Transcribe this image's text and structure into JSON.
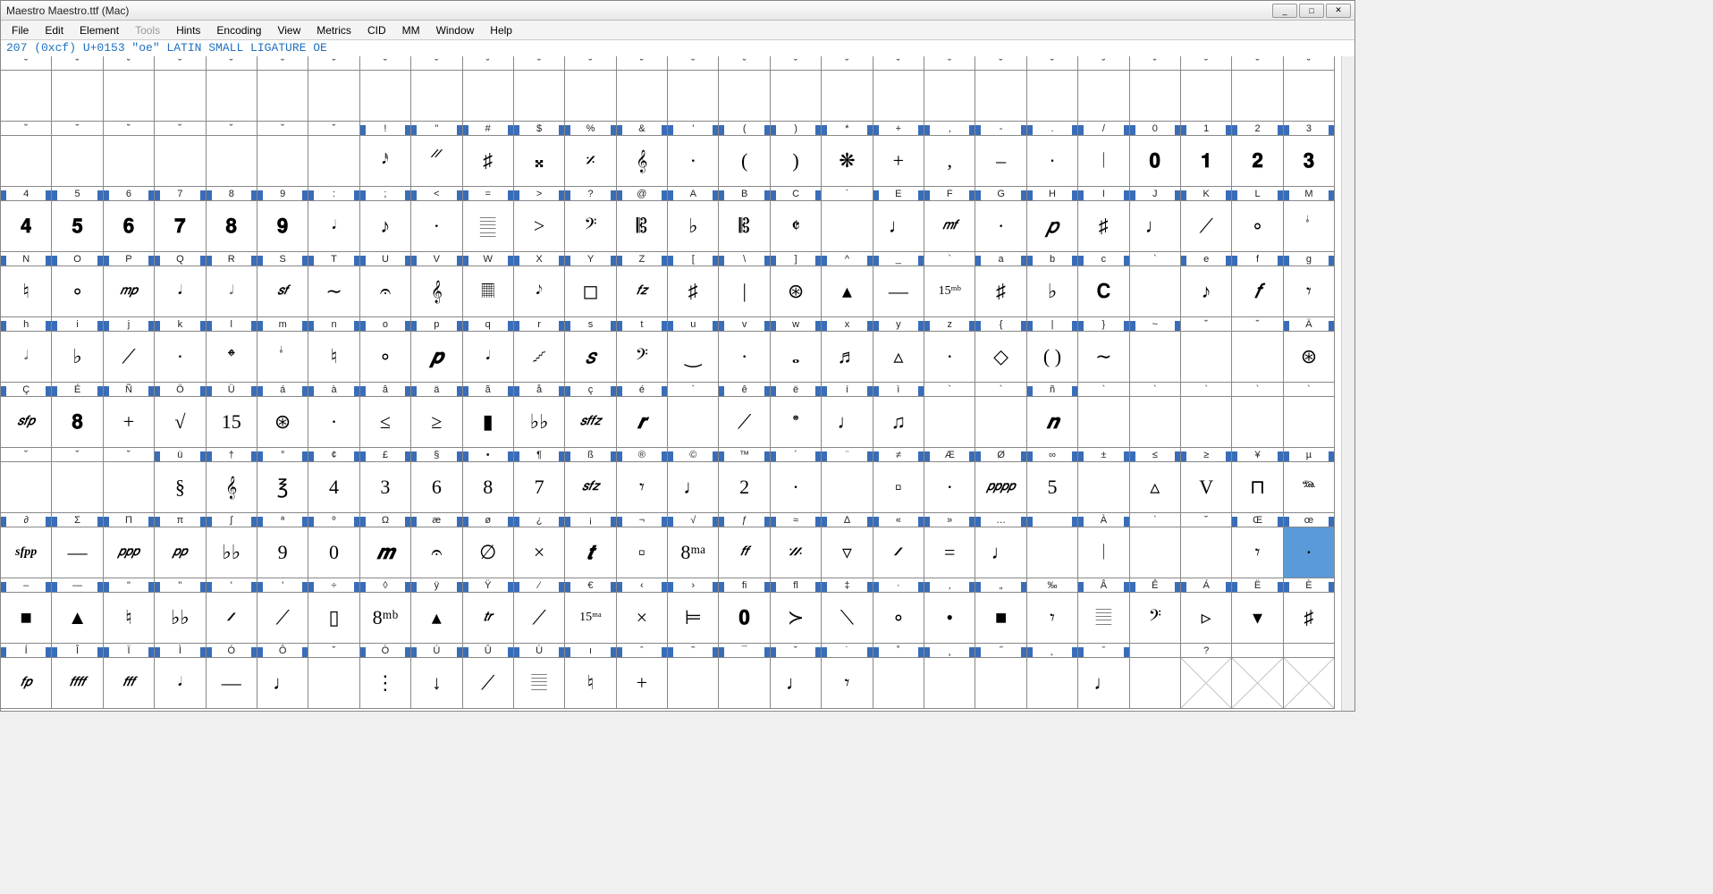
{
  "window": {
    "title": "Maestro  Maestro.ttf (Mac)",
    "min": "_",
    "max": "□",
    "close": "✕"
  },
  "menu": [
    "File",
    "Edit",
    "Element",
    "Tools",
    "Hints",
    "Encoding",
    "View",
    "Metrics",
    "CID",
    "MM",
    "Window",
    "Help"
  ],
  "menu_disabled": [
    "Tools"
  ],
  "status": "207 (0xcf) U+0153 \"oe\" LATIN SMALL LIGATURE OE",
  "rows": [
    {
      "hdr": [
        "˘",
        "˘",
        "˘",
        "˘",
        "˘",
        "˘",
        "˘",
        "˘",
        "˘",
        "˘",
        "˘",
        "˘",
        "˘",
        "˘",
        "˘",
        "˘",
        "˘",
        "˘",
        "˘",
        "˘",
        "˘",
        "˘",
        "˘",
        "˘",
        "˘",
        "˘"
      ],
      "mod": [
        0,
        0,
        0,
        0,
        0,
        0,
        0,
        0,
        0,
        0,
        0,
        0,
        0,
        0,
        0,
        0,
        0,
        0,
        0,
        0,
        0,
        0,
        0,
        0,
        0,
        0
      ],
      "cell": [
        "",
        "",
        "",
        "",
        "",
        "",
        "",
        "",
        "",
        "",
        "",
        "",
        "",
        "",
        "",
        "",
        "",
        "",
        "",
        "",
        "",
        "",
        "",
        "",
        "",
        ""
      ]
    },
    {
      "hdr": [
        "˘",
        "˘",
        "˘",
        "˘",
        "˘",
        "˘",
        "˘",
        "!",
        "\"",
        "#",
        "$",
        "%",
        "&",
        "'",
        "(",
        ")",
        "*",
        "+",
        ",",
        "-",
        ".",
        "/",
        "0",
        "1",
        "2",
        "3"
      ],
      "mod": [
        0,
        0,
        0,
        0,
        0,
        0,
        0,
        1,
        1,
        1,
        1,
        1,
        1,
        1,
        1,
        1,
        1,
        1,
        1,
        1,
        1,
        1,
        1,
        1,
        1,
        1
      ],
      "cell": [
        "",
        "",
        "",
        "",
        "",
        "",
        "",
        "𝅘𝅥𝅰",
        "𝄓",
        "♯",
        "𝄪",
        "𝄎",
        "𝄞",
        "·",
        "(",
        ")",
        "❋",
        "+",
        ",",
        "–",
        "·",
        "𝄀",
        "𝟎",
        "𝟏",
        "𝟐",
        "𝟑"
      ]
    },
    {
      "hdr": [
        "4",
        "5",
        "6",
        "7",
        "8",
        "9",
        ":",
        ";",
        "<",
        "=",
        ">",
        "?",
        "@",
        "A",
        "B",
        "C",
        "`",
        "E",
        "F",
        "G",
        "H",
        "I",
        "J",
        "K",
        "L",
        "M"
      ],
      "mod": [
        1,
        1,
        1,
        1,
        1,
        1,
        1,
        1,
        1,
        1,
        1,
        1,
        1,
        1,
        1,
        1,
        0,
        1,
        1,
        1,
        1,
        1,
        1,
        1,
        1,
        1
      ],
      "cell": [
        "𝟒",
        "𝟓",
        "𝟔",
        "𝟕",
        "𝟖",
        "𝟗",
        "𝅘𝅥",
        "♪",
        "·",
        "𝄛",
        ">",
        "𝄢",
        "𝄡",
        "♭",
        "𝄡",
        "𝄵",
        "",
        "♩",
        "𝑚𝑓",
        "·",
        "𝑝",
        "♯",
        "♩",
        "⟋",
        "∘",
        "𝆭"
      ]
    },
    {
      "hdr": [
        "N",
        "O",
        "P",
        "Q",
        "R",
        "S",
        "T",
        "U",
        "V",
        "W",
        "X",
        "Y",
        "Z",
        "[",
        "\\",
        "]",
        "^",
        "_",
        "`",
        "a",
        "b",
        "c",
        "`",
        "e",
        "f",
        "g"
      ],
      "mod": [
        1,
        1,
        1,
        1,
        1,
        1,
        1,
        1,
        1,
        1,
        1,
        1,
        1,
        1,
        1,
        1,
        1,
        1,
        0,
        1,
        1,
        1,
        0,
        1,
        1,
        1
      ],
      "cell": [
        "♮",
        "∘",
        "𝑚𝑝",
        "𝅘𝅥",
        "𝅗𝅥",
        "𝑠𝑓",
        "∼",
        "𝄐",
        "𝄞",
        "𝄜",
        "𝅘𝅥𝅮",
        "◻",
        "𝑓𝑧",
        "♯",
        "|",
        "⊛",
        "▴",
        "—",
        "15ᵐᵇ",
        "♯",
        "♭",
        "𝐂",
        "",
        "♪",
        "𝑓",
        "𝄾"
      ]
    },
    {
      "hdr": [
        "h",
        "i",
        "j",
        "k",
        "l",
        "m",
        "n",
        "o",
        "p",
        "q",
        "r",
        "s",
        "t",
        "u",
        "v",
        "w",
        "x",
        "y",
        "z",
        "{",
        "|",
        "}",
        "~",
        "˘",
        "˘",
        "Ä"
      ],
      "mod": [
        1,
        1,
        1,
        1,
        1,
        1,
        1,
        1,
        1,
        1,
        1,
        1,
        1,
        1,
        1,
        1,
        1,
        1,
        1,
        1,
        1,
        1,
        1,
        0,
        0,
        1
      ],
      "cell": [
        "𝅗𝅥",
        "♭",
        "⟋",
        "·",
        "𝄌",
        "𝆭",
        "♮",
        "∘",
        "𝒑",
        "𝅘𝅥",
        "𝆱",
        "𝑠",
        "𝄢",
        "‿",
        "·",
        "𝅝",
        "♬",
        "▵",
        "·",
        "◇",
        "( )",
        "∼",
        "",
        "",
        "",
        "⊛"
      ]
    },
    {
      "hdr": [
        "Ç",
        "É",
        "Ñ",
        "Ö",
        "Ü",
        "á",
        "à",
        "â",
        "ä",
        "ã",
        "å",
        "ç",
        "é",
        "`",
        "ê",
        "ë",
        "í",
        "ì",
        "`",
        "`",
        "ñ",
        "`",
        "`",
        "`",
        "`",
        "`"
      ],
      "mod": [
        1,
        1,
        1,
        1,
        1,
        1,
        1,
        1,
        1,
        1,
        1,
        1,
        1,
        0,
        1,
        1,
        1,
        1,
        0,
        0,
        1,
        0,
        0,
        0,
        0,
        0
      ],
      "cell": [
        "𝑠𝑓𝑝",
        "𝟖",
        "+",
        "√",
        "15",
        "⊛",
        "·",
        "≤",
        "≥",
        "▮",
        "♭♭",
        "𝑠𝑓𝑓𝑧",
        "𝒓",
        "",
        "⟋",
        "𝆯",
        "♩",
        "♫",
        "",
        "",
        "𝒏",
        "",
        "",
        "",
        "",
        ""
      ]
    },
    {
      "hdr": [
        "˘",
        "˘",
        "˘",
        "ü",
        "†",
        "°",
        "¢",
        "£",
        "§",
        "•",
        "¶",
        "ß",
        "®",
        "©",
        "™",
        "´",
        "¨",
        "≠",
        "Æ",
        "Ø",
        "∞",
        "±",
        "≤",
        "≥",
        "¥",
        "µ"
      ],
      "mod": [
        0,
        0,
        0,
        1,
        1,
        1,
        1,
        1,
        1,
        1,
        1,
        1,
        1,
        1,
        1,
        1,
        1,
        1,
        1,
        1,
        1,
        1,
        1,
        1,
        1,
        1
      ],
      "cell": [
        "",
        "",
        "",
        "§",
        "𝄞",
        "℥",
        "4",
        "3",
        "6",
        "8",
        "7",
        "𝑠𝑓𝑧",
        "𝄾",
        "♩",
        "2",
        "·",
        "",
        "▫",
        "·",
        "𝑝𝑝𝑝𝑝",
        "5",
        "",
        "▵",
        "V",
        "⊓",
        "𝆮"
      ]
    },
    {
      "hdr": [
        "∂",
        "Σ",
        "Π",
        "π",
        "∫",
        "ª",
        "º",
        "Ω",
        "æ",
        "ø",
        "¿",
        "¡",
        "¬",
        "√",
        "ƒ",
        "≈",
        "∆",
        "«",
        "»",
        "…",
        " ",
        "À",
        "`",
        "˘",
        "Œ",
        "œ"
      ],
      "mod": [
        1,
        1,
        1,
        1,
        1,
        1,
        1,
        1,
        1,
        1,
        1,
        1,
        1,
        1,
        1,
        1,
        1,
        1,
        1,
        1,
        1,
        1,
        0,
        0,
        1,
        1
      ],
      "cell": [
        "sfpp",
        "—",
        "𝑝𝑝𝑝",
        "𝑝𝑝",
        "♭♭",
        "9",
        "0",
        "𝒎",
        "𝄐",
        "∅",
        "×",
        "𝒕",
        "▫",
        "8ᵐᵃ",
        "𝑓𝑓",
        "𝄏",
        "▿",
        "𝄍",
        "=",
        "♩",
        "",
        "𝄀",
        "",
        "",
        "𝄾",
        "·"
      ]
    },
    {
      "hdr": [
        "–",
        "—",
        "\"",
        "\"",
        "'",
        "'",
        "÷",
        "◊",
        "ÿ",
        "Ÿ",
        "⁄",
        "€",
        "‹",
        "›",
        "ﬁ",
        "ﬂ",
        "‡",
        "·",
        "‚",
        "„",
        "‰",
        "Â",
        "Ê",
        "Á",
        "Ë",
        "È"
      ],
      "mod": [
        1,
        1,
        1,
        1,
        1,
        1,
        1,
        1,
        1,
        1,
        1,
        1,
        1,
        1,
        1,
        1,
        1,
        1,
        1,
        1,
        0,
        1,
        1,
        1,
        1,
        1
      ],
      "cell": [
        "■",
        "▲",
        "♮",
        "♭♭",
        "𝄍",
        "⟋",
        "▯",
        "8ᵐᵇ",
        "▴",
        "𝑡𝑟",
        "⟋",
        "15ᵐᵃ",
        "×",
        "⊨",
        "𝟎",
        "≻",
        "⟍",
        "∘",
        "•",
        "■",
        "𝄾",
        "𝄚",
        "𝄢",
        "▹",
        "▾",
        "♯"
      ]
    },
    {
      "hdr": [
        "Í",
        "Î",
        "Ï",
        "Ì",
        "Ó",
        "Ô",
        "˘",
        "Ò",
        "Ú",
        "Û",
        "Ù",
        "ı",
        "ˆ",
        "˜",
        "¯",
        "˘",
        "˙",
        "˚",
        "¸",
        "˝",
        "˛",
        "ˇ",
        " ",
        "?",
        " ",
        " "
      ],
      "mod": [
        1,
        1,
        1,
        1,
        1,
        1,
        0,
        1,
        1,
        1,
        1,
        1,
        1,
        1,
        1,
        1,
        1,
        1,
        1,
        1,
        1,
        1,
        0,
        0,
        0,
        0
      ],
      "cell": [
        "𝑓𝑝",
        "𝑓𝑓𝑓𝑓",
        "𝑓𝑓𝑓",
        "𝅘𝅥",
        "—",
        "♩",
        "",
        "⋮",
        "↓",
        "⟋",
        "𝄚",
        "♮",
        "+",
        "",
        "",
        "♩",
        "𝄾",
        "",
        "",
        "",
        "",
        "♩",
        "",
        "",
        "",
        ""
      ]
    }
  ],
  "selected": {
    "row": 7,
    "col": 25
  },
  "empty_x": [
    [
      9,
      23
    ],
    [
      9,
      24
    ],
    [
      9,
      25
    ]
  ]
}
